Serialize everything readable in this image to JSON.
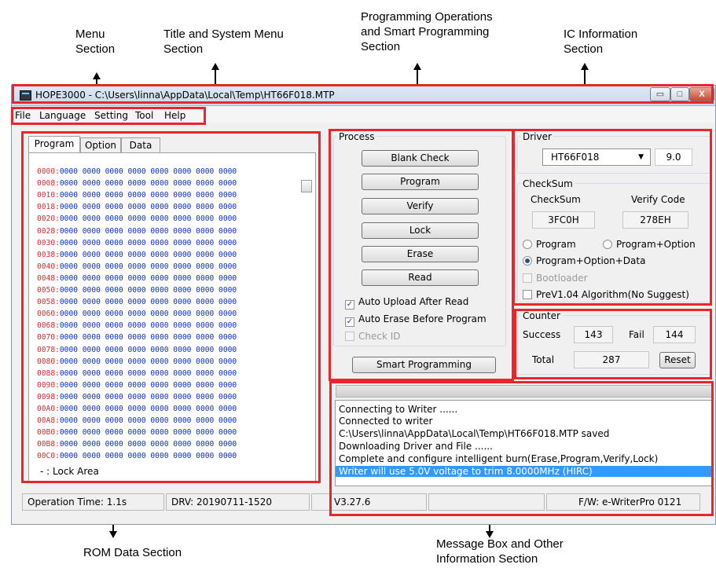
{
  "callouts": {
    "menu": "Menu\nSection",
    "title": "Title and System Menu\nSection",
    "programming": "Programming Operations\nand Smart Programming\nSection",
    "ic": "IC Information\nSection",
    "rom": "ROM Data Section",
    "message": "Message Box and Other\nInformation Section"
  },
  "window": {
    "title": "HOPE3000 - C:\\Users\\linna\\AppData\\Local\\Temp\\HT66F018.MTP",
    "controls": {
      "minimize": "▭",
      "maximize": "□",
      "close": "X"
    }
  },
  "menu": [
    "File",
    "Language",
    "Setting",
    "Tool",
    "Help"
  ],
  "rom": {
    "tabs": [
      "Program",
      "Option",
      "Data"
    ],
    "addresses": [
      "0000:",
      "0008:",
      "0010:",
      "0018:",
      "0020:",
      "0028:",
      "0030:",
      "0038:",
      "0040:",
      "0048:",
      "0050:",
      "0058:",
      "0060:",
      "0068:",
      "0070:",
      "0078:",
      "0080:",
      "0088:",
      "0090:",
      "0098:",
      "00A0:",
      "00A8:",
      "00B0:",
      "00B8:",
      "00C0:"
    ],
    "row_data": "0000 0000 0000 0000 0000 0000 0000 0000",
    "lock_note": "- : Lock Area"
  },
  "process": {
    "label": "Process",
    "buttons": [
      "Blank Check",
      "Program",
      "Verify",
      "Lock",
      "Erase",
      "Read"
    ],
    "auto_upload": "Auto Upload After Read",
    "auto_erase": "Auto Erase Before Program",
    "check_id": "Check ID",
    "check_mark": "✓",
    "smart": "Smart Programming"
  },
  "driver": {
    "label": "Driver",
    "selected": "HT66F018",
    "version": "9.0",
    "checksum_label": "CheckSum",
    "checksum_header": "CheckSum",
    "verify_header": "Verify Code",
    "checksum_value": "3FC0H",
    "verify_value": "278EH",
    "radio_program": "Program",
    "radio_program_option": "Program+Option",
    "radio_all": "Program+Option+Data",
    "bootloader": "Bootloader",
    "prev_algo": "PreV1.04 Algorithm(No Suggest)"
  },
  "counter": {
    "label": "Counter",
    "success_label": "Success",
    "success": "143",
    "fail_label": "Fail",
    "fail": "144",
    "total_label": "Total",
    "total": "287",
    "reset": "Reset"
  },
  "messages": [
    "Connecting to Writer ......",
    "Connected to writer",
    "C:\\Users\\linna\\AppData\\Local\\Temp\\HT66F018.MTP saved",
    "Downloading Driver and File ......",
    "Complete and configure intelligent burn(Erase,Program,Verify,Lock)",
    "Writer will use 5.0V voltage to trim 8.0000MHz (HIRC)"
  ],
  "status": {
    "op_time": "Operation Time: 1.1s",
    "drv": "DRV: 20190711-1520",
    "version": "V3.27.6",
    "fw": "F/W: e-WriterPro 0121"
  },
  "colors": {
    "highlight": "#e8262b",
    "address": "#e8262b",
    "data": "#0b2fc7",
    "selection": "#3399ff"
  },
  "icons": [
    "app-icon",
    "dropdown-arrow-icon",
    "scrollbar-thumb"
  ]
}
